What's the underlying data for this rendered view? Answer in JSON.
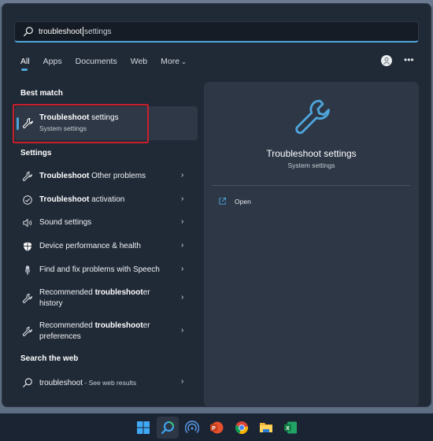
{
  "search": {
    "typed": "troubleshoot",
    "suggestion": "settings"
  },
  "tabs": [
    {
      "label": "All",
      "active": true
    },
    {
      "label": "Apps"
    },
    {
      "label": "Documents"
    },
    {
      "label": "Web"
    },
    {
      "label": "More"
    }
  ],
  "header_icons": {
    "avatar": "user-avatar-icon",
    "more": "•••"
  },
  "best_match": {
    "section_label": "Best match",
    "title_bold": "Troubleshoot",
    "title_rest": " settings",
    "subtitle": "System settings"
  },
  "settings": {
    "section_label": "Settings",
    "items": [
      {
        "bold": "Troubleshoot",
        "rest": " Other problems",
        "icon": "wrench-icon"
      },
      {
        "bold": "Troubleshoot",
        "rest": " activation",
        "icon": "check-circle-icon"
      },
      {
        "pre": "Sound settings",
        "icon": "speaker-icon"
      },
      {
        "pre": "Device performance & health",
        "icon": "shield-icon"
      },
      {
        "pre": "Find and fix problems with Speech",
        "icon": "microphone-icon"
      },
      {
        "pre": "Recommended ",
        "bold": "troubleshoot",
        "rest": "er",
        "line2": "history",
        "icon": "wrench-icon"
      },
      {
        "pre": "Recommended ",
        "bold": "troubleshoot",
        "rest": "er",
        "line2": "preferences",
        "icon": "wrench-icon"
      }
    ]
  },
  "web": {
    "section_label": "Search the web",
    "query": "troubleshoot",
    "suffix": " - See web results"
  },
  "preview": {
    "title": "Troubleshoot settings",
    "subtitle": "System settings",
    "open_label": "Open"
  },
  "taskbar": {
    "icons": [
      "start-icon",
      "search-icon",
      "network-icon",
      "powerpoint-icon",
      "chrome-icon",
      "file-explorer-icon",
      "excel-icon"
    ]
  },
  "colors": {
    "accent": "#4ea6dc",
    "highlight_border": "#c8202a"
  }
}
